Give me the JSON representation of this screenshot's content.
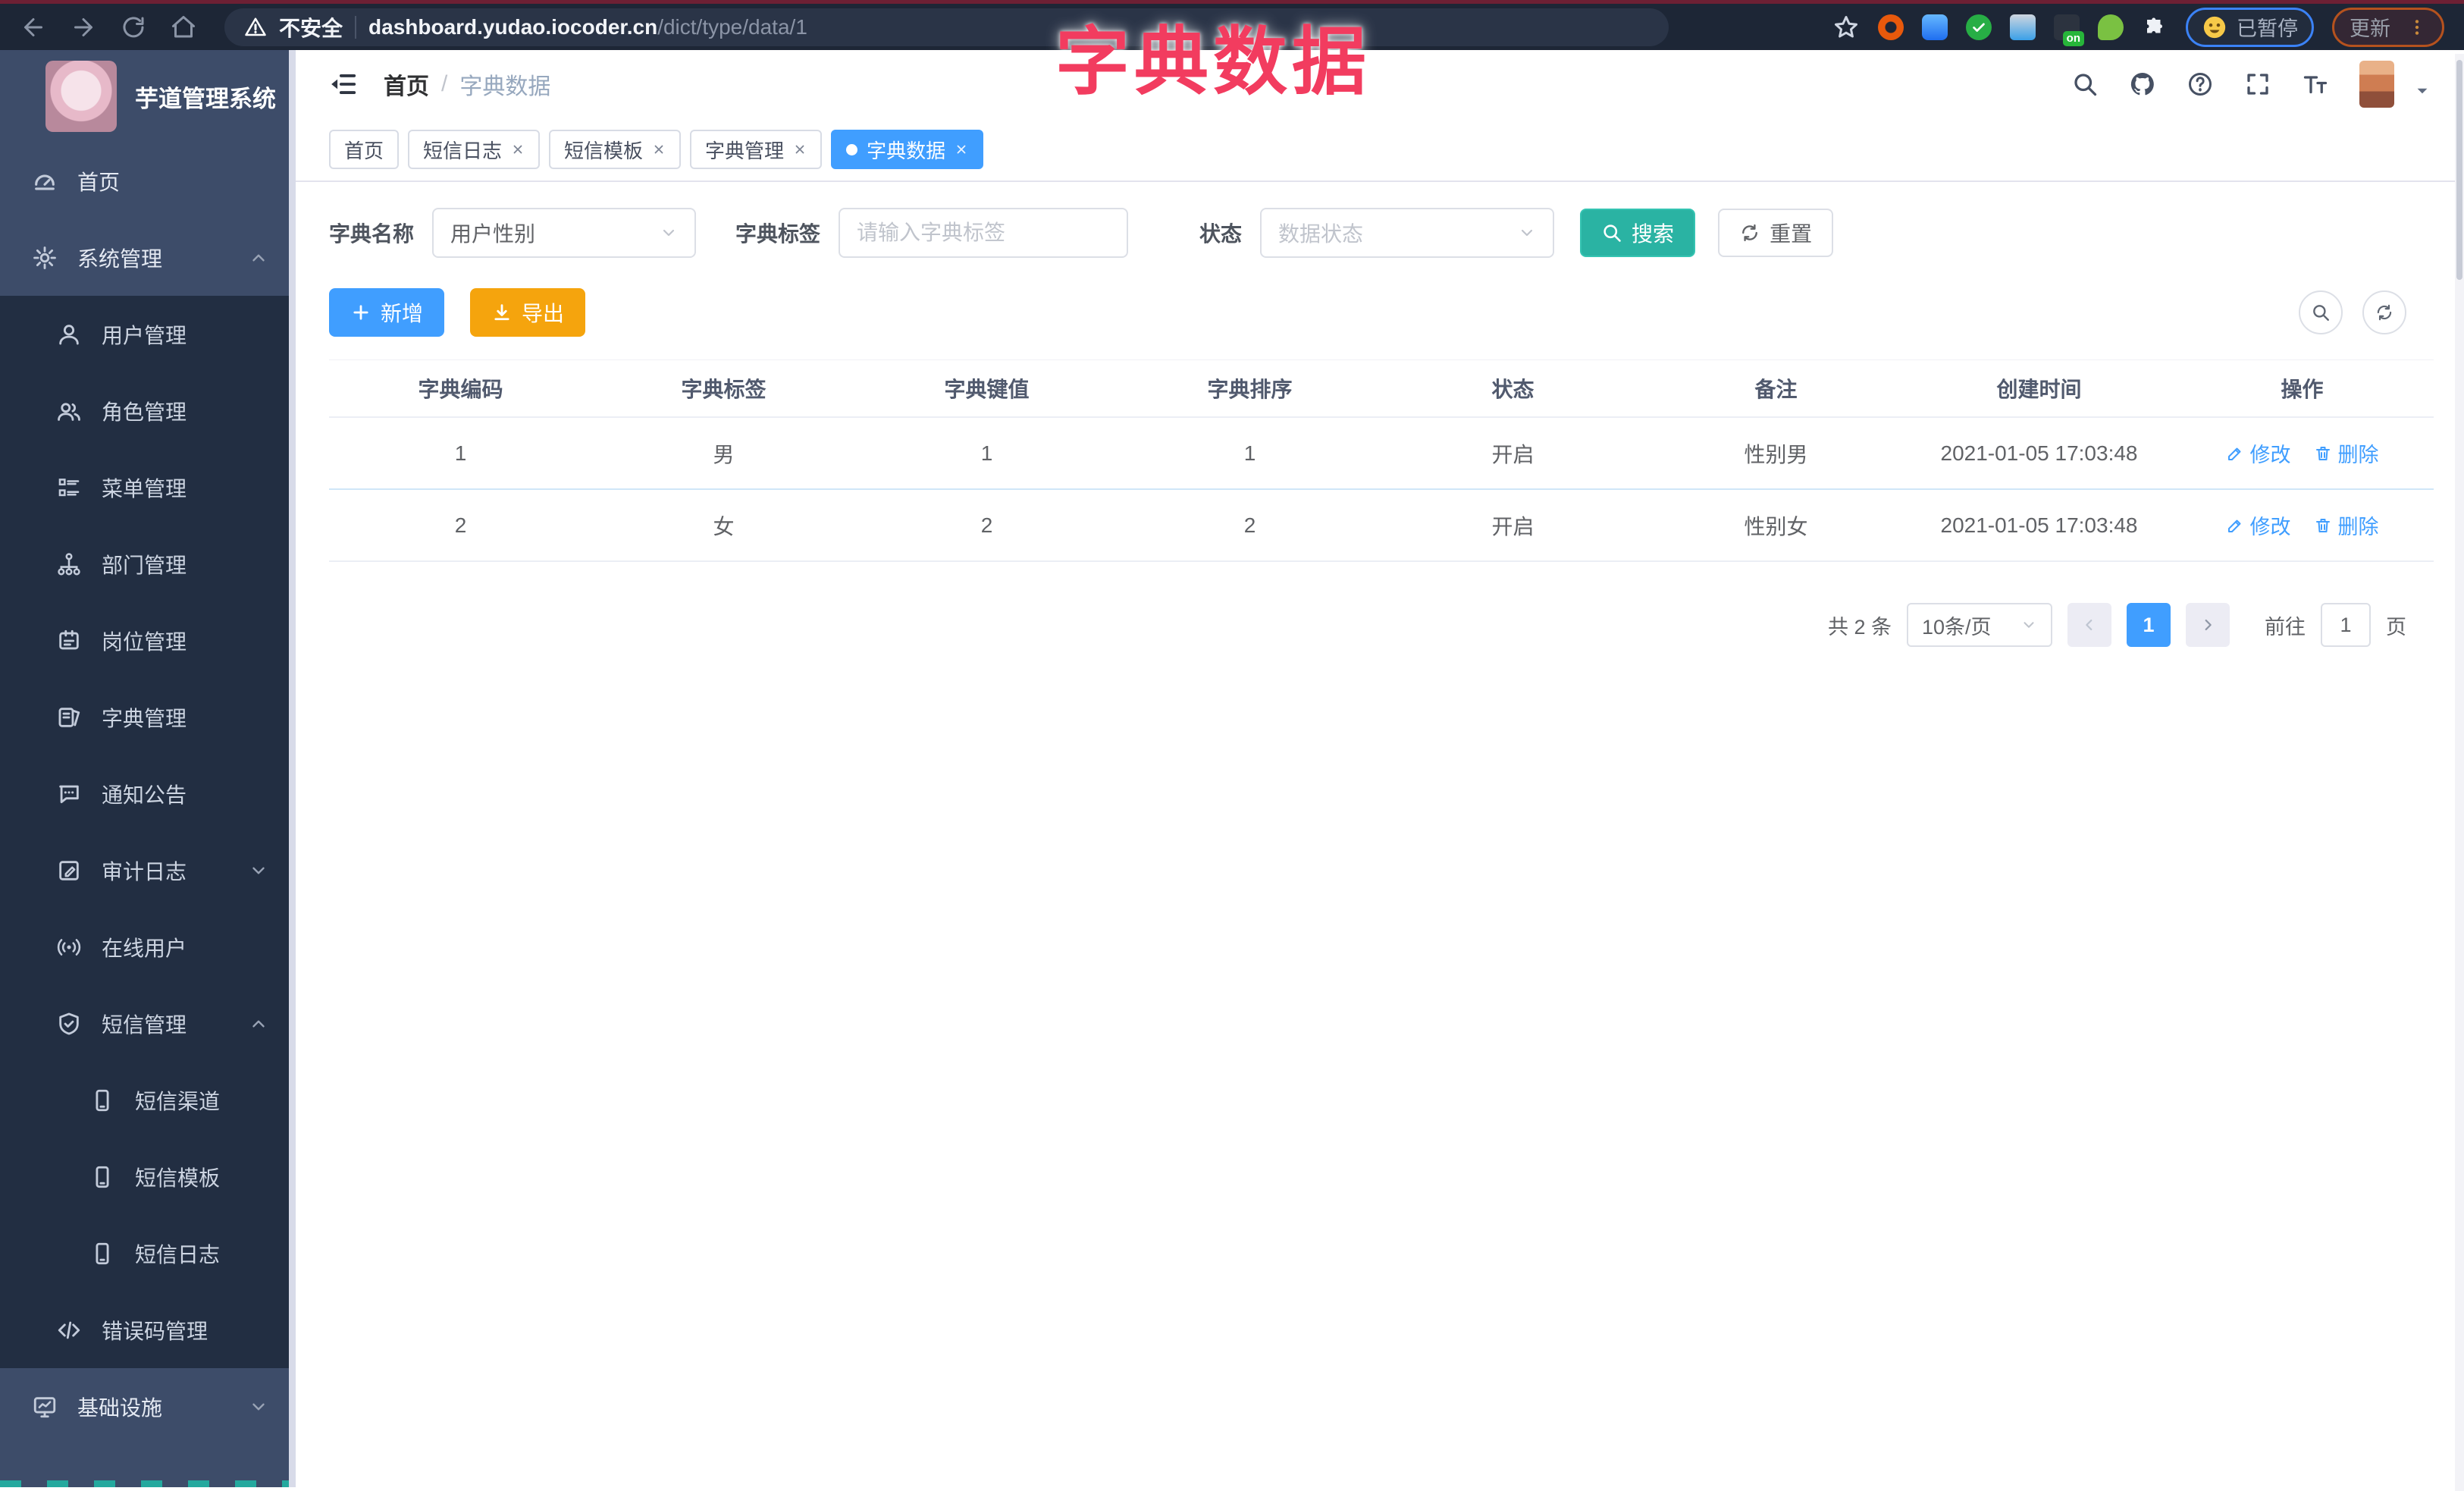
{
  "colors": {
    "primary": "#409eff",
    "search_teal": "#2ab3a3",
    "export_orange": "#f5a40d",
    "overlay_red": "#f23c5f",
    "sidebar_bg": "#3d4c69",
    "submenu_bg": "#222e42",
    "browser_bar_bg": "#1d2636"
  },
  "browser": {
    "security_label": "不安全",
    "url_domain": "dashboard.yudao.iocoder.cn",
    "url_path": "/dict/type/data/1",
    "extension_badge": "on",
    "profile_status": "已暂停",
    "update_label": "更新"
  },
  "overlay_title": "字典数据",
  "sidebar": {
    "app_title": "芋道管理系统",
    "items": [
      {
        "label": "首页"
      },
      {
        "label": "系统管理"
      },
      {
        "label": "用户管理"
      },
      {
        "label": "角色管理"
      },
      {
        "label": "菜单管理"
      },
      {
        "label": "部门管理"
      },
      {
        "label": "岗位管理"
      },
      {
        "label": "字典管理"
      },
      {
        "label": "通知公告"
      },
      {
        "label": "审计日志"
      },
      {
        "label": "在线用户"
      },
      {
        "label": "短信管理"
      },
      {
        "label": "短信渠道"
      },
      {
        "label": "短信模板"
      },
      {
        "label": "短信日志"
      },
      {
        "label": "错误码管理"
      },
      {
        "label": "基础设施"
      }
    ]
  },
  "breadcrumb": {
    "home": "首页",
    "separator": "/",
    "current": "字典数据"
  },
  "tabs": [
    {
      "label": "首页"
    },
    {
      "label": "短信日志"
    },
    {
      "label": "短信模板"
    },
    {
      "label": "字典管理"
    },
    {
      "label": "字典数据"
    }
  ],
  "filters": {
    "dict_name_label": "字典名称",
    "dict_name_value": "用户性别",
    "dict_label_label": "字典标签",
    "dict_label_placeholder": "请输入字典标签",
    "status_label": "状态",
    "status_placeholder": "数据状态",
    "search_label": "搜索",
    "reset_label": "重置"
  },
  "toolbar": {
    "add_label": "新增",
    "export_label": "导出"
  },
  "table": {
    "columns": [
      "字典编码",
      "字典标签",
      "字典键值",
      "字典排序",
      "状态",
      "备注",
      "创建时间",
      "操作"
    ],
    "edit_label": "修改",
    "delete_label": "删除",
    "rows": [
      {
        "code": "1",
        "label": "男",
        "value": "1",
        "sort": "1",
        "status": "开启",
        "remark": "性别男",
        "created": "2021-01-05 17:03:48"
      },
      {
        "code": "2",
        "label": "女",
        "value": "2",
        "sort": "2",
        "status": "开启",
        "remark": "性别女",
        "created": "2021-01-05 17:03:48"
      }
    ]
  },
  "pagination": {
    "total": "共 2 条",
    "page_size": "10条/页",
    "current_page": "1",
    "goto_label": "前往",
    "goto_value": "1",
    "page_unit": "页"
  }
}
